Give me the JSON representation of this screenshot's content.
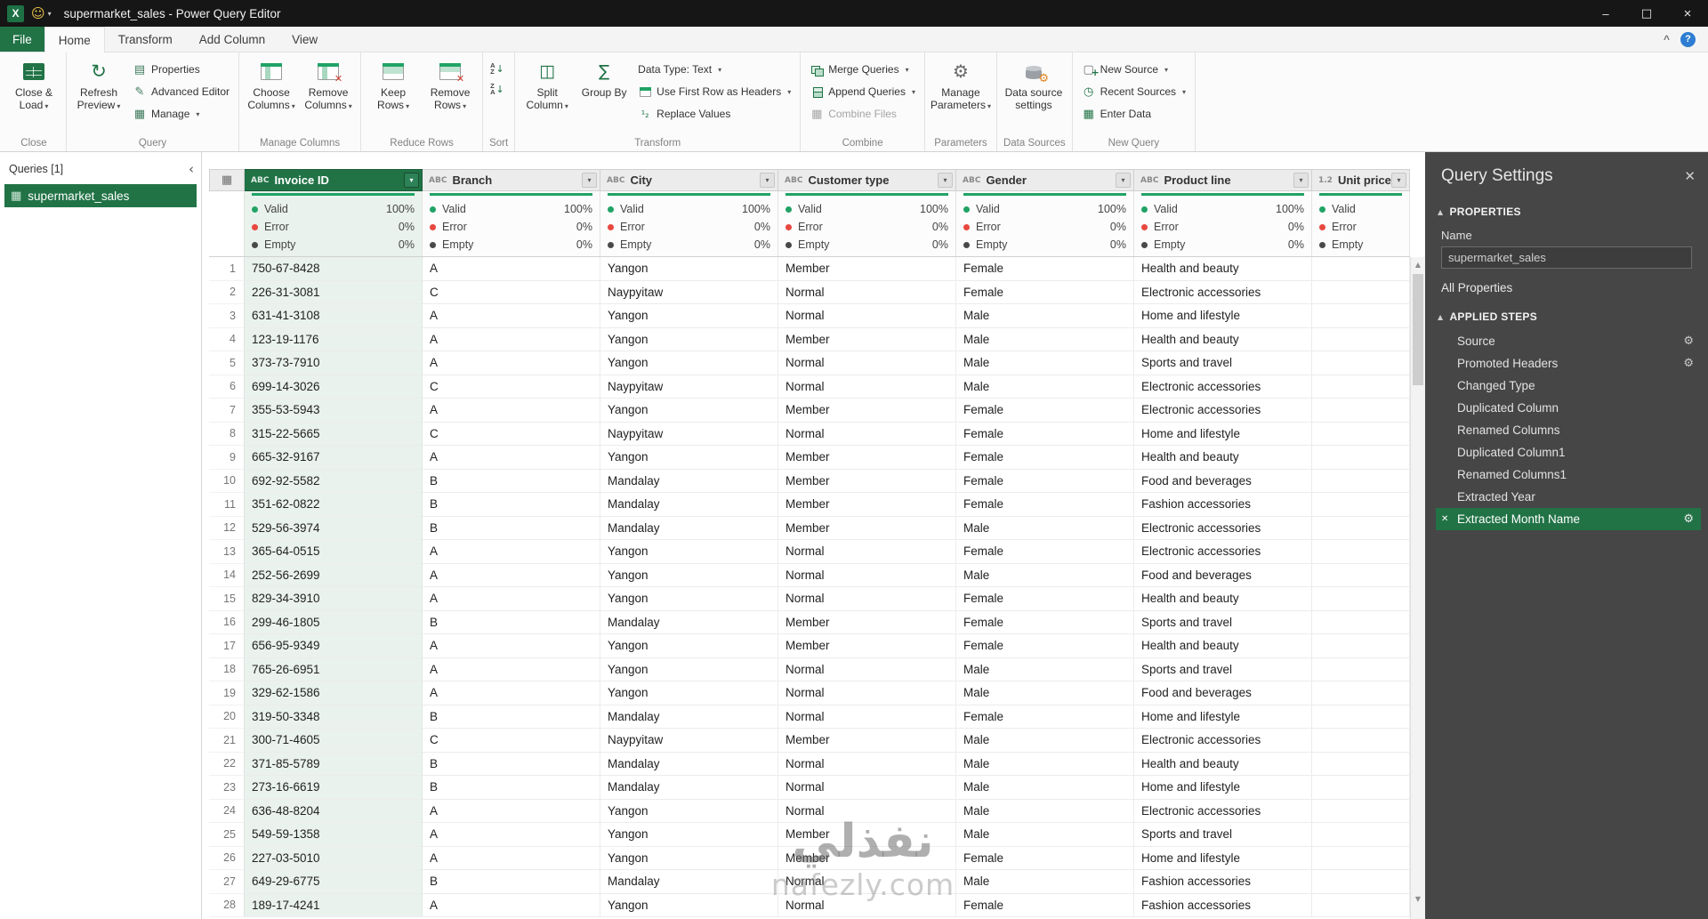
{
  "colors": {
    "accent_green": "#217346",
    "valid_dot": "#21a366",
    "error_dot": "#e8483f",
    "empty_dot": "#494949",
    "settings_panel_bg": "#464646"
  },
  "titlebar": {
    "title": "supermarket_sales - Power Query Editor"
  },
  "ribbon": {
    "tabs": [
      {
        "label": "File"
      },
      {
        "label": "Home"
      },
      {
        "label": "Transform"
      },
      {
        "label": "Add Column"
      },
      {
        "label": "View"
      }
    ],
    "active_tab": "Home",
    "buttons": {
      "close_load": "Close & Load",
      "refresh_preview": "Refresh Preview",
      "properties": "Properties",
      "advanced_editor": "Advanced Editor",
      "manage": "Manage",
      "choose_columns": "Choose Columns",
      "remove_columns": "Remove Columns",
      "keep_rows": "Keep Rows",
      "remove_rows": "Remove Rows",
      "split_column": "Split Column",
      "group_by": "Group By",
      "data_type": "Data Type: Text",
      "use_first_row": "Use First Row as Headers",
      "replace_values": "Replace Values",
      "merge_queries": "Merge Queries",
      "append_queries": "Append Queries",
      "combine_files": "Combine Files",
      "manage_parameters": "Manage Parameters",
      "data_source_settings": "Data source settings",
      "new_source": "New Source",
      "recent_sources": "Recent Sources",
      "enter_data": "Enter Data"
    },
    "group_labels": [
      "Close",
      "Query",
      "Manage Columns",
      "Reduce Rows",
      "Sort",
      "Transform",
      "Combine",
      "Parameters",
      "Data Sources",
      "New Query"
    ]
  },
  "queries_panel": {
    "header": "Queries [1]",
    "items": [
      {
        "label": "supermarket_sales",
        "selected": true
      }
    ]
  },
  "grid": {
    "quality_labels": {
      "valid": "Valid",
      "error": "Error",
      "empty": "Empty"
    },
    "columns": [
      {
        "type": "ABC",
        "name": "Invoice ID",
        "selected": true,
        "quality": {
          "valid": "100%",
          "error": "0%",
          "empty": "0%"
        }
      },
      {
        "type": "ABC",
        "name": "Branch",
        "quality": {
          "valid": "100%",
          "error": "0%",
          "empty": "0%"
        }
      },
      {
        "type": "ABC",
        "name": "City",
        "quality": {
          "valid": "100%",
          "error": "0%",
          "empty": "0%"
        }
      },
      {
        "type": "ABC",
        "name": "Customer type",
        "quality": {
          "valid": "100%",
          "error": "0%",
          "empty": "0%"
        }
      },
      {
        "type": "ABC",
        "name": "Gender",
        "quality": {
          "valid": "100%",
          "error": "0%",
          "empty": "0%"
        }
      },
      {
        "type": "ABC",
        "name": "Product line",
        "quality": {
          "valid": "100%",
          "error": "0%",
          "empty": "0%"
        }
      },
      {
        "type": "1.2",
        "name": "Unit price",
        "quality": {
          "valid": "",
          "error": "",
          "empty": ""
        }
      }
    ],
    "rows": [
      {
        "n": 1,
        "invoice": "750-67-8428",
        "branch": "A",
        "city": "Yangon",
        "customer": "Member",
        "gender": "Female",
        "product": "Health and beauty",
        "unit_price": ""
      },
      {
        "n": 2,
        "invoice": "226-31-3081",
        "branch": "C",
        "city": "Naypyitaw",
        "customer": "Normal",
        "gender": "Female",
        "product": "Electronic accessories",
        "unit_price": ""
      },
      {
        "n": 3,
        "invoice": "631-41-3108",
        "branch": "A",
        "city": "Yangon",
        "customer": "Normal",
        "gender": "Male",
        "product": "Home and lifestyle",
        "unit_price": ""
      },
      {
        "n": 4,
        "invoice": "123-19-1176",
        "branch": "A",
        "city": "Yangon",
        "customer": "Member",
        "gender": "Male",
        "product": "Health and beauty",
        "unit_price": ""
      },
      {
        "n": 5,
        "invoice": "373-73-7910",
        "branch": "A",
        "city": "Yangon",
        "customer": "Normal",
        "gender": "Male",
        "product": "Sports and travel",
        "unit_price": ""
      },
      {
        "n": 6,
        "invoice": "699-14-3026",
        "branch": "C",
        "city": "Naypyitaw",
        "customer": "Normal",
        "gender": "Male",
        "product": "Electronic accessories",
        "unit_price": ""
      },
      {
        "n": 7,
        "invoice": "355-53-5943",
        "branch": "A",
        "city": "Yangon",
        "customer": "Member",
        "gender": "Female",
        "product": "Electronic accessories",
        "unit_price": ""
      },
      {
        "n": 8,
        "invoice": "315-22-5665",
        "branch": "C",
        "city": "Naypyitaw",
        "customer": "Normal",
        "gender": "Female",
        "product": "Home and lifestyle",
        "unit_price": ""
      },
      {
        "n": 9,
        "invoice": "665-32-9167",
        "branch": "A",
        "city": "Yangon",
        "customer": "Member",
        "gender": "Female",
        "product": "Health and beauty",
        "unit_price": ""
      },
      {
        "n": 10,
        "invoice": "692-92-5582",
        "branch": "B",
        "city": "Mandalay",
        "customer": "Member",
        "gender": "Female",
        "product": "Food and beverages",
        "unit_price": ""
      },
      {
        "n": 11,
        "invoice": "351-62-0822",
        "branch": "B",
        "city": "Mandalay",
        "customer": "Member",
        "gender": "Female",
        "product": "Fashion accessories",
        "unit_price": ""
      },
      {
        "n": 12,
        "invoice": "529-56-3974",
        "branch": "B",
        "city": "Mandalay",
        "customer": "Member",
        "gender": "Male",
        "product": "Electronic accessories",
        "unit_price": ""
      },
      {
        "n": 13,
        "invoice": "365-64-0515",
        "branch": "A",
        "city": "Yangon",
        "customer": "Normal",
        "gender": "Female",
        "product": "Electronic accessories",
        "unit_price": ""
      },
      {
        "n": 14,
        "invoice": "252-56-2699",
        "branch": "A",
        "city": "Yangon",
        "customer": "Normal",
        "gender": "Male",
        "product": "Food and beverages",
        "unit_price": ""
      },
      {
        "n": 15,
        "invoice": "829-34-3910",
        "branch": "A",
        "city": "Yangon",
        "customer": "Normal",
        "gender": "Female",
        "product": "Health and beauty",
        "unit_price": ""
      },
      {
        "n": 16,
        "invoice": "299-46-1805",
        "branch": "B",
        "city": "Mandalay",
        "customer": "Member",
        "gender": "Female",
        "product": "Sports and travel",
        "unit_price": ""
      },
      {
        "n": 17,
        "invoice": "656-95-9349",
        "branch": "A",
        "city": "Yangon",
        "customer": "Member",
        "gender": "Female",
        "product": "Health and beauty",
        "unit_price": ""
      },
      {
        "n": 18,
        "invoice": "765-26-6951",
        "branch": "A",
        "city": "Yangon",
        "customer": "Normal",
        "gender": "Male",
        "product": "Sports and travel",
        "unit_price": ""
      },
      {
        "n": 19,
        "invoice": "329-62-1586",
        "branch": "A",
        "city": "Yangon",
        "customer": "Normal",
        "gender": "Male",
        "product": "Food and beverages",
        "unit_price": ""
      },
      {
        "n": 20,
        "invoice": "319-50-3348",
        "branch": "B",
        "city": "Mandalay",
        "customer": "Normal",
        "gender": "Female",
        "product": "Home and lifestyle",
        "unit_price": ""
      },
      {
        "n": 21,
        "invoice": "300-71-4605",
        "branch": "C",
        "city": "Naypyitaw",
        "customer": "Member",
        "gender": "Male",
        "product": "Electronic accessories",
        "unit_price": ""
      },
      {
        "n": 22,
        "invoice": "371-85-5789",
        "branch": "B",
        "city": "Mandalay",
        "customer": "Normal",
        "gender": "Male",
        "product": "Health and beauty",
        "unit_price": ""
      },
      {
        "n": 23,
        "invoice": "273-16-6619",
        "branch": "B",
        "city": "Mandalay",
        "customer": "Normal",
        "gender": "Male",
        "product": "Home and lifestyle",
        "unit_price": ""
      },
      {
        "n": 24,
        "invoice": "636-48-8204",
        "branch": "A",
        "city": "Yangon",
        "customer": "Normal",
        "gender": "Male",
        "product": "Electronic accessories",
        "unit_price": ""
      },
      {
        "n": 25,
        "invoice": "549-59-1358",
        "branch": "A",
        "city": "Yangon",
        "customer": "Member",
        "gender": "Male",
        "product": "Sports and travel",
        "unit_price": ""
      },
      {
        "n": 26,
        "invoice": "227-03-5010",
        "branch": "A",
        "city": "Yangon",
        "customer": "Member",
        "gender": "Female",
        "product": "Home and lifestyle",
        "unit_price": ""
      },
      {
        "n": 27,
        "invoice": "649-29-6775",
        "branch": "B",
        "city": "Mandalay",
        "customer": "Normal",
        "gender": "Male",
        "product": "Fashion accessories",
        "unit_price": ""
      },
      {
        "n": 28,
        "invoice": "189-17-4241",
        "branch": "A",
        "city": "Yangon",
        "customer": "Normal",
        "gender": "Female",
        "product": "Fashion accessories",
        "unit_price": ""
      }
    ]
  },
  "query_settings": {
    "title": "Query Settings",
    "properties_header": "PROPERTIES",
    "name_label": "Name",
    "name_value": "supermarket_sales",
    "all_properties": "All Properties",
    "applied_steps_header": "APPLIED STEPS",
    "steps": [
      {
        "label": "Source",
        "gear": true
      },
      {
        "label": "Promoted Headers",
        "gear": true
      },
      {
        "label": "Changed Type",
        "gear": false
      },
      {
        "label": "Duplicated Column",
        "gear": false
      },
      {
        "label": "Renamed Columns",
        "gear": false
      },
      {
        "label": "Duplicated Column1",
        "gear": false
      },
      {
        "label": "Renamed Columns1",
        "gear": false
      },
      {
        "label": "Extracted Year",
        "gear": false
      },
      {
        "label": "Extracted Month Name",
        "gear": true,
        "selected": true
      }
    ]
  },
  "watermark": {
    "line1": "نفذلي",
    "line2": "nafezly.com"
  }
}
